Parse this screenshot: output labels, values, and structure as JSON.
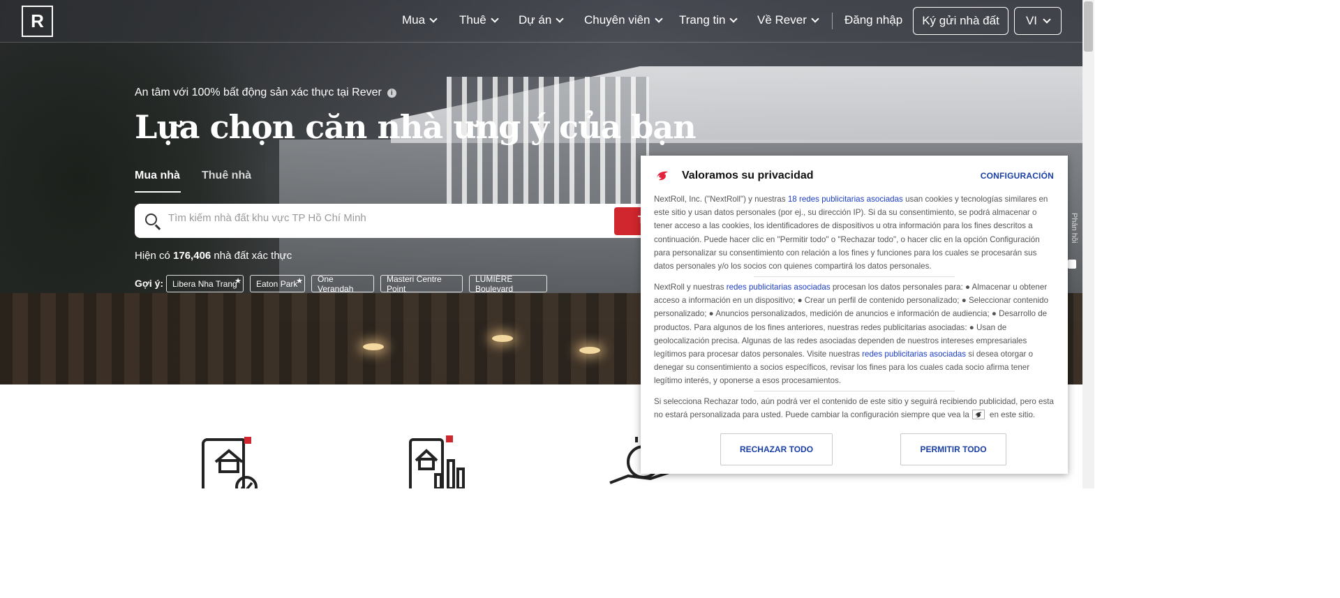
{
  "nav": {
    "logo_letter": "R",
    "items": [
      {
        "label": "Mua"
      },
      {
        "label": "Thuê"
      },
      {
        "label": "Dự án"
      },
      {
        "label": "Chuyên viên"
      },
      {
        "label": "Trang tin"
      },
      {
        "label": "Về Rever"
      }
    ],
    "login": "Đăng nhập",
    "consign": "Ký gửi nhà đất",
    "language": "VI"
  },
  "hero": {
    "tagline": "An tâm với 100% bất động sản xác thực tại Rever",
    "info_glyph": "i",
    "headline": "Lựa chọn căn nhà ưng ý của bạn",
    "tabs": [
      {
        "label": "Mua nhà"
      },
      {
        "label": "Thuê nhà"
      }
    ],
    "search_placeholder": "Tìm kiếm nhà đất khu vực TP Hồ Chí Minh",
    "search_button": "T",
    "count_prefix": "Hiện có ",
    "count_value": "176,406",
    "count_suffix": " nhà đất xác thực",
    "suggest_label": "Gợi ý:",
    "suggestions": [
      {
        "label": "Libera Nha Trang",
        "star": "★"
      },
      {
        "label": "Eaton Park",
        "star": "★"
      },
      {
        "label": "One Verandah",
        "star": ""
      },
      {
        "label": "Masteri Centre Point",
        "star": ""
      },
      {
        "label": "LUMIÈRE Boulevard",
        "star": ""
      }
    ]
  },
  "side_tab": {
    "label": "Phản hồi"
  },
  "privacy": {
    "title": "Valoramos su privacidad",
    "config": "CONFIGURACIÓN",
    "p1_a": "NextRoll, Inc. (\"NextRoll\") y nuestras ",
    "p1_link": "18 redes publicitarias asociadas",
    "p1_b": " usan cookies y tecnologías similares en este sitio y usan datos personales (por ej., su dirección IP). Si da su consentimiento, se podrá almacenar o tener acceso a las cookies, los identificadores de dispositivos u otra información para los fines descritos a continuación. Puede hacer clic en \"Permitir todo\" o \"Rechazar todo\", o hacer clic en la opción Configuración para personalizar su consentimiento con relación a los fines y funciones para los cuales se procesarán sus datos personales y/o los socios con quienes compartirá los datos personales.",
    "p2_a": "NextRoll y nuestras ",
    "p2_link1": "redes publicitarias asociadas",
    "p2_b": " procesan los datos personales para: ● Almacenar u obtener acceso a información en un dispositivo; ● Crear un perfil de contenido personalizado; ● Seleccionar contenido personalizado; ● Anuncios personalizados, medición de anuncios e información de audiencia; ● Desarrollo de productos. Para algunos de los fines anteriores, nuestras redes publicitarias asociadas: ● Usan de geolocalización precisa. Algunas de las redes asociadas dependen de nuestros intereses empresariales legítimos para procesar datos personales. Visite nuestras ",
    "p2_link2": "redes publicitarias asociadas",
    "p2_c": " si desea otorgar o denegar su consentimiento a socios específicos, revisar los fines para los cuales cada socio afirma tener legítimo interés, y oponerse a esos procesamientos.",
    "p3_a": "Si selecciona Rechazar todo, aún podrá ver el contenido de este sitio y seguirá recibiendo publicidad, pero esta no estará personalizada para usted. Puede cambiar la configuración siempre que vea la",
    "p3_b": " en este sitio.",
    "reject": "RECHAZAR TODO",
    "accept": "PERMITIR TODO"
  },
  "colors": {
    "brand_red": "#d0262d",
    "link_blue": "#1b3ec9"
  }
}
